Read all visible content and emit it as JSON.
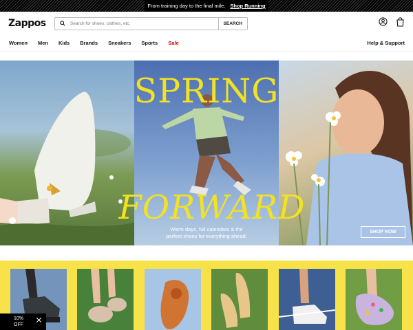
{
  "promo": {
    "text": "From training day to the final mile.",
    "link": "Shop Running"
  },
  "header": {
    "logo": "Zappos",
    "search_placeholder": "Search for shoes, clothes, etc.",
    "search_button": "SEARCH"
  },
  "nav": {
    "items": [
      "Women",
      "Men",
      "Kids",
      "Brands",
      "Sneakers",
      "Sports",
      "Sale"
    ],
    "help": "Help & Support"
  },
  "hero": {
    "headline_1": "SPRING",
    "headline_2": "FORWARD",
    "subtext_1": "Warm days, full calendars & the",
    "subtext_2": "perfect shoes for everything ahead.",
    "button": "SHOP NOW"
  },
  "offer": {
    "line_1": "10%",
    "line_2": "OFF"
  },
  "colors": {
    "accent_yellow": "#f3e222",
    "sale_red": "#d60000",
    "band_yellow": "#f7e24a"
  }
}
